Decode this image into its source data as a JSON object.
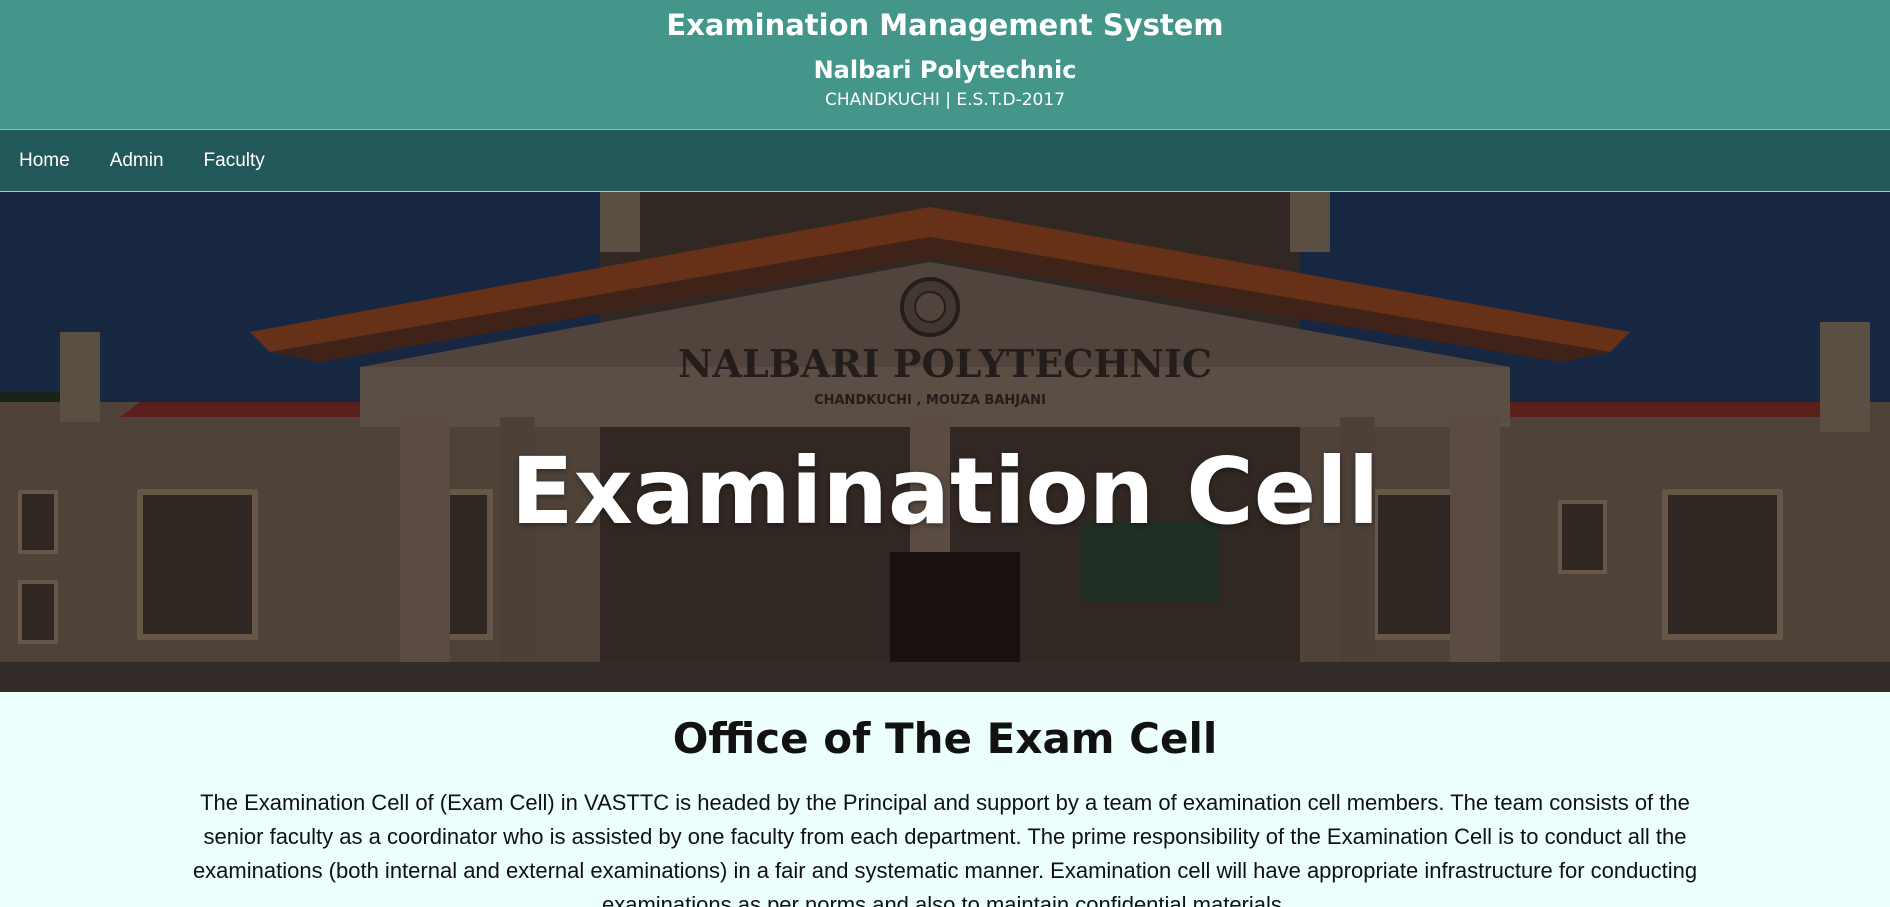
{
  "header": {
    "title": "Examination Management System",
    "institution": "Nalbari Polytechnic",
    "subtitle": "CHANDKUCHI | E.S.T.D-2017"
  },
  "nav": {
    "items": [
      {
        "label": "Home"
      },
      {
        "label": "Admin"
      },
      {
        "label": "Faculty"
      }
    ]
  },
  "hero": {
    "title": "Examination Cell",
    "building_sign": "NALBARI POLYTECHNIC",
    "building_subsign": "CHANDKUCHI , MOUZA BAHJANI"
  },
  "main": {
    "heading": "Office of The Exam Cell",
    "paragraph": "The Examination Cell of (Exam Cell) in VASTTC is headed by the Principal and support by a team of examination cell members. The team consists of the senior faculty as a coordinator who is assisted by one faculty from each department. The prime responsibility of the Examination Cell is to conduct all the examinations (both internal and external examinations) in a fair and systematic manner. Examination cell will have appropriate infrastructure for conducting examinations as per norms and also to maintain confidential materials."
  },
  "colors": {
    "header_bg": "#44968a",
    "nav_bg": "#23585a",
    "page_bg": "#ecfffd"
  }
}
